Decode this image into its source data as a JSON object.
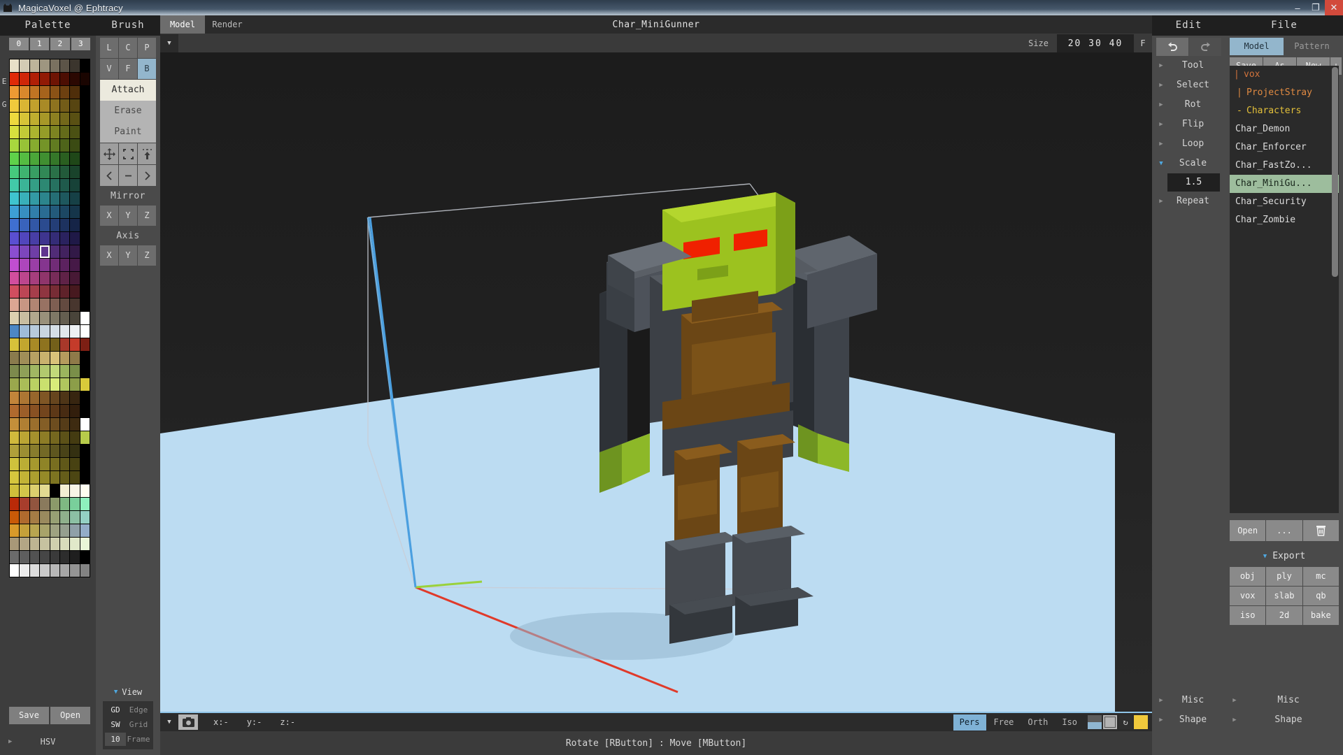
{
  "window": {
    "title": "MagicaVoxel @ Ephtracy",
    "icon": "app-icon",
    "buttons": [
      "minimize",
      "maximize",
      "close"
    ],
    "minimize_glyph": "–",
    "maximize_glyph": "❐",
    "close_glyph": "✕"
  },
  "palette": {
    "header": "Palette",
    "column_numbers": [
      "0",
      "1",
      "2",
      "3"
    ],
    "side_labels": [
      "E",
      "G"
    ],
    "save_label": "Save",
    "open_label": "Open",
    "hsv_label": "HSV",
    "hsv_triangle": "▶",
    "selected_index": 115,
    "colors": [
      "#e8e0c8",
      "#d3cbb4",
      "#bdb49a",
      "#9e9680",
      "#7a7160",
      "#5c5448",
      "#3b352d",
      "#000000",
      "#e02a08",
      "#cf2608",
      "#b01f06",
      "#911a05",
      "#6e1404",
      "#4c0e03",
      "#2b0802",
      "#1a0501",
      "#ee9a33",
      "#d9882c",
      "#c07423",
      "#a6631c",
      "#8a5216",
      "#6d4010",
      "#4f2e0a",
      "#000000",
      "#f0c93c",
      "#d9b534",
      "#c2a02d",
      "#a98a26",
      "#8e731f",
      "#735c18",
      "#574511",
      "#000000",
      "#edd93e",
      "#d7c437",
      "#bfae2f",
      "#a79828",
      "#8d8021",
      "#73681a",
      "#595013",
      "#000000",
      "#d7e03e",
      "#c2ca37",
      "#acb42f",
      "#959d28",
      "#7d8421",
      "#646b1a",
      "#4b5113",
      "#000000",
      "#a8d83e",
      "#97c237",
      "#86ab2f",
      "#749428",
      "#617b21",
      "#4e641a",
      "#3b4b13",
      "#000000",
      "#5fd14a",
      "#55bc42",
      "#4ba639",
      "#408f31",
      "#357729",
      "#2a5f20",
      "#1f4718",
      "#000000",
      "#46c97d",
      "#3fb470",
      "#389e63",
      "#318856",
      "#2a7148",
      "#225a3a",
      "#19432b",
      "#000000",
      "#42c9a8",
      "#3bb497",
      "#349e85",
      "#2d8873",
      "#267160",
      "#1f5a4c",
      "#174238",
      "#000000",
      "#3fc4cf",
      "#39b0ba",
      "#339aa4",
      "#2c858d",
      "#256e75",
      "#1e585e",
      "#164046",
      "#000000",
      "#3d9fd6",
      "#378fc1",
      "#317eab",
      "#2a6c93",
      "#235a7b",
      "#1c4763",
      "#15354a",
      "#000000",
      "#3f6fd1",
      "#3963bc",
      "#3257a6",
      "#2b4b8f",
      "#243e77",
      "#1d325f",
      "#152447",
      "#000000",
      "#5a4fd1",
      "#5146bc",
      "#483ea6",
      "#3e358f",
      "#342c77",
      "#2a225f",
      "#1f1947",
      "#000000",
      "#8b4ed1",
      "#7d46bc",
      "#6f3ea6",
      "#60358f",
      "#512c77",
      "#42225f",
      "#321947",
      "#000000",
      "#c04ed1",
      "#ad46bc",
      "#9a3ea6",
      "#85358f",
      "#712c77",
      "#5c225f",
      "#461947",
      "#000000",
      "#d14e9e",
      "#bc468d",
      "#a63e7d",
      "#8f356b",
      "#772c59",
      "#5f2247",
      "#471935",
      "#000000",
      "#d14e5f",
      "#bc4655",
      "#a63e4b",
      "#8f3540",
      "#772c35",
      "#5f222a",
      "#47191f",
      "#000000",
      "#dba693",
      "#c79683",
      "#b18573",
      "#987263",
      "#7e5e52",
      "#634a40",
      "#48362e",
      "#000000",
      "#dcd0b0",
      "#c8bda0",
      "#b2a88e",
      "#99917b",
      "#7f7866",
      "#645e50",
      "#49443a",
      "#ffffff",
      "#4d87c4",
      "#9fbcd8",
      "#b8cbdc",
      "#c9d6e0",
      "#d6dfe6",
      "#e2e8ec",
      "#eef1f3",
      "#ffffff",
      "#d7c23a",
      "#c2a62f",
      "#a98a26",
      "#8e731f",
      "#73601a",
      "#a8382a",
      "#c43b2a",
      "#7d1f14",
      "#8a7b4d",
      "#a08e58",
      "#b7a163",
      "#c9b26e",
      "#d9c27a",
      "#b59b5e",
      "#8f7a49",
      "#000000",
      "#7d8a4d",
      "#8fa058",
      "#a1b763",
      "#b2c96e",
      "#c2d97a",
      "#9bb55e",
      "#7a8f49",
      "#000000",
      "#9aa84d",
      "#aabd58",
      "#bad163",
      "#cae06e",
      "#d8ec7a",
      "#b0c65e",
      "#8c9e49",
      "#d9c93a",
      "#c2853a",
      "#ad7633",
      "#97662c",
      "#7f5625",
      "#66451e",
      "#4e3517",
      "#372510",
      "#000000",
      "#b06a2e",
      "#9c5e29",
      "#885123",
      "#73451d",
      "#5d3817",
      "#472b12",
      "#321e0c",
      "#000000",
      "#c48f3a",
      "#b07f33",
      "#9b6f2d",
      "#845e26",
      "#6d4d1f",
      "#553c18",
      "#3e2b11",
      "#ffffff",
      "#d0b93c",
      "#bba534",
      "#a5912d",
      "#8d7c26",
      "#75671f",
      "#5c5118",
      "#443b11",
      "#b7cb4a",
      "#b0a03a",
      "#9c8e33",
      "#887c2d",
      "#736926",
      "#5e561f",
      "#494318",
      "#343011",
      "#000000",
      "#cfc23c",
      "#bbae35",
      "#a6992e",
      "#8f8427",
      "#786e20",
      "#605819",
      "#484212",
      "#000000",
      "#d6c63d",
      "#c2b336",
      "#ac9f2f",
      "#958a28",
      "#7d7421",
      "#655d1a",
      "#4c4613",
      "#000000",
      "#cfbf3b",
      "#d3c64a",
      "#dccf6e",
      "#e3da92",
      "#ecе5b6",
      "#f3eed2",
      "#f8f5e6",
      "#fffdf0",
      "#b92a08",
      "#a83d2c",
      "#92553f",
      "#8a7a5d",
      "#8b9a6a",
      "#7fb882",
      "#79cf9b",
      "#8ef0bd",
      "#c95a08",
      "#b06a2e",
      "#a57c45",
      "#9a8a5e",
      "#97a074",
      "#8fb08c",
      "#8cc0a4",
      "#94d0c4",
      "#d99a2a",
      "#c5a03a",
      "#b8a550",
      "#a8a36a",
      "#9ea281",
      "#959f8f",
      "#8fa0a8",
      "#93acc8",
      "#a89878",
      "#b3a685",
      "#bdb492",
      "#c6c2a0",
      "#cfcfae",
      "#d8dcbc",
      "#e1e9ca",
      "#eaf6d8",
      "#6b6b6b",
      "#5e5e5e",
      "#525252",
      "#464646",
      "#3a3a3a",
      "#2d2d2d",
      "#1f1f1f",
      "#000000",
      "#ffffff",
      "#ededed",
      "#dcdcdc",
      "#cacaca",
      "#b8b8b8",
      "#a6a6a6",
      "#949494",
      "#828282"
    ]
  },
  "brush": {
    "header": "Brush",
    "shape_row1": [
      "L",
      "C",
      "P"
    ],
    "shape_row2": [
      "V",
      "F",
      "B"
    ],
    "active_shape": "B",
    "modes": [
      "Attach",
      "Erase",
      "Paint"
    ],
    "active_mode": "Attach",
    "tool_icons": [
      "move-icon",
      "select-box-icon",
      "extrude-up-icon"
    ],
    "nav_icons": [
      "prev-icon",
      "minus-icon",
      "next-icon"
    ],
    "mirror_label": "Mirror",
    "mirror_axes": [
      "X",
      "Y",
      "Z"
    ],
    "axis_label": "Axis",
    "axis_axes": [
      "X",
      "Y",
      "Z"
    ]
  },
  "view": {
    "header": "View",
    "triangle": "▼",
    "rows": [
      {
        "key": "GD",
        "label": "Edge",
        "boxed": false
      },
      {
        "key": "SW",
        "label": "Grid",
        "boxed": false
      },
      {
        "key": "10",
        "label": "Frame",
        "boxed": true
      }
    ]
  },
  "center": {
    "tabs": [
      {
        "label": "Model",
        "active": true
      },
      {
        "label": "Render",
        "active": false
      }
    ],
    "model_title": "Char_MiniGunner",
    "size_label": "Size",
    "size_value": "20 30 40",
    "fit_label": "F",
    "panel_triangle": "▼",
    "camera_icon": "camera-icon",
    "coords": [
      "x:-",
      "y:-",
      "z:-"
    ],
    "projections": [
      "Pers",
      "Free",
      "Orth",
      "Iso"
    ],
    "active_projection": "Pers",
    "shading_icons": [
      "shade-gradient-icon",
      "shade-grid-icon",
      "shade-rotate-icon",
      "shade-color-icon"
    ],
    "status_text": "Rotate [RButton] : Move [MButton]"
  },
  "edit": {
    "header": "Edit",
    "undo_icon": "undo-icon",
    "redo_icon": "redo-icon",
    "items": [
      {
        "label": "Tool",
        "expanded": false
      },
      {
        "label": "Select",
        "expanded": false
      },
      {
        "label": "Rot",
        "expanded": false
      },
      {
        "label": "Flip",
        "expanded": false
      },
      {
        "label": "Loop",
        "expanded": false
      },
      {
        "label": "Scale",
        "expanded": true,
        "value": "1.5"
      },
      {
        "label": "Repeat",
        "expanded": false
      }
    ],
    "closed_triangle": "▶",
    "open_triangle": "▼"
  },
  "file": {
    "header": "File",
    "tabs": [
      {
        "label": "Model",
        "active": true
      },
      {
        "label": "Pattern",
        "active": false
      }
    ],
    "ops": [
      "Save",
      "As",
      "New"
    ],
    "plus_label": "+",
    "tree": [
      {
        "mark": "|",
        "label": "vox",
        "color": "#d2733c",
        "level": 0
      },
      {
        "mark": "|",
        "label": "ProjectStray",
        "color": "#e08a42",
        "level": 1
      },
      {
        "mark": "-",
        "label": "Characters",
        "color": "#e3c03a",
        "level": 1
      }
    ],
    "files": [
      {
        "label": "Char_Demon",
        "selected": false
      },
      {
        "label": "Char_Enforcer",
        "selected": false
      },
      {
        "label": "Char_FastZo...",
        "selected": false
      },
      {
        "label": "Char_MiniGu...",
        "selected": true
      },
      {
        "label": "Char_Security",
        "selected": false
      },
      {
        "label": "Char_Zombie",
        "selected": false
      }
    ],
    "open_label": "Open",
    "browse_label": "...",
    "delete_icon": "trash-icon",
    "export": {
      "header": "Export",
      "triangle": "▼",
      "formats": [
        "obj",
        "ply",
        "mc",
        "vox",
        "slab",
        "qb",
        "iso",
        "2d",
        "bake"
      ]
    },
    "misc_label": "Misc",
    "shape_label": "Shape",
    "closed_triangle": "▶"
  },
  "colors": {
    "accent_blue": "#7fb2d6",
    "selection_green": "#9dbd9d",
    "floor_blue": "#bcdcf2",
    "axis_red": "#e03a2a",
    "axis_green": "#9ad13a",
    "axis_blue": "#4a9fe0"
  }
}
